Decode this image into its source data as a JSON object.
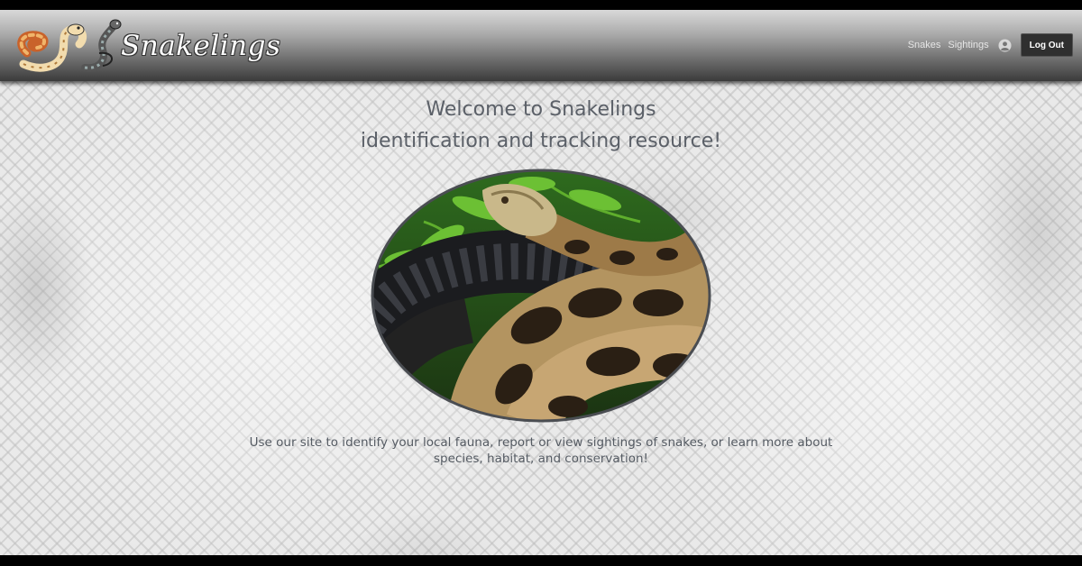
{
  "header": {
    "brand": "Snakelings",
    "nav": {
      "snakes": "Snakes",
      "sightings": "Sightings",
      "logout": "Log Out"
    },
    "icons": {
      "logo": "snake-logo-icon",
      "user": "user-account-icon"
    }
  },
  "main": {
    "headline_line1": "Welcome to Snakelings",
    "headline_line2": "identification and tracking resource!",
    "intro_line1": "Use our site to identify your local fauna, report or view sightings of snakes, or learn more about",
    "intro_line2": "species, habitat, and conservation!"
  },
  "colors": {
    "header_top": "#d9d9d9",
    "header_bottom": "#3b3b3b",
    "text": "#5b6068",
    "logout_bg": "#2f2f2f"
  }
}
